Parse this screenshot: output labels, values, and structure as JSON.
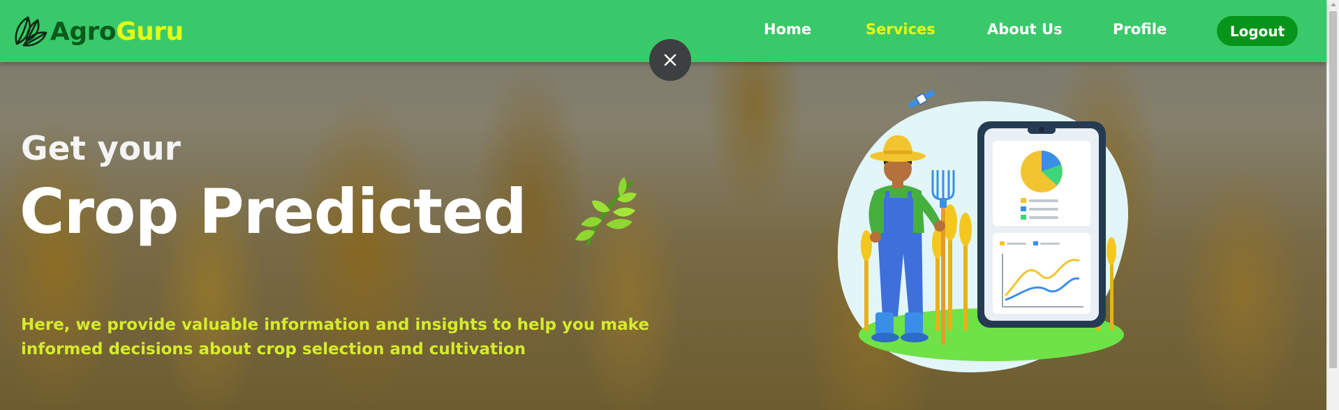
{
  "brand": {
    "part1": "Agro",
    "part2": "Guru",
    "colors": {
      "part1": "#0b5b1b",
      "part2": "#e4ff14"
    },
    "icon": "leaf-icon"
  },
  "nav": {
    "items": [
      {
        "label": "Home",
        "active": false
      },
      {
        "label": "Services",
        "active": true
      },
      {
        "label": "About Us",
        "active": false
      },
      {
        "label": "Profile",
        "active": false
      }
    ],
    "logout_label": "Logout",
    "colors": {
      "bar": "#3ac96a",
      "active": "#e4ff14",
      "logout": "#06951a"
    }
  },
  "overlay": {
    "close_icon": "close-icon"
  },
  "hero": {
    "subtitle": "Get your",
    "title": "Crop Predicted",
    "title_icon": "sprout-icon",
    "description": "Here, we provide valuable information and insights to help you make informed decisions about crop selection and cultivation",
    "description_color": "#d6ec2b",
    "illustration": "farmer-with-phone-analytics-illustration"
  }
}
